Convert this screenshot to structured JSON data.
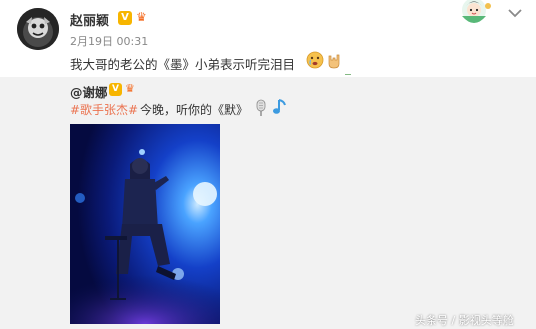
{
  "post": {
    "username": "赵丽颖",
    "verified_badge": "V",
    "member_icon": "crown-icon",
    "timestamp": "2月19日 00:31",
    "text": "我大哥的老公的《墨》小弟表示听完泪目",
    "emojis": [
      "tear-face-emoji",
      "rock-hand-emoji"
    ]
  },
  "repost": {
    "username": "@谢娜",
    "verified_badge": "V",
    "member_icon": "crown-icon",
    "hashtag": "#歌手张杰#",
    "text": "今晚，听你的《默》",
    "emojis": [
      "microphone-emoji",
      "music-note-emoji"
    ]
  },
  "watermark": "头条号 / 影视头等舱",
  "colors": {
    "hashtag": "#eb7350",
    "verified": "#f7b500",
    "repost_bg": "#f2f2f2",
    "timestamp": "#888888"
  }
}
